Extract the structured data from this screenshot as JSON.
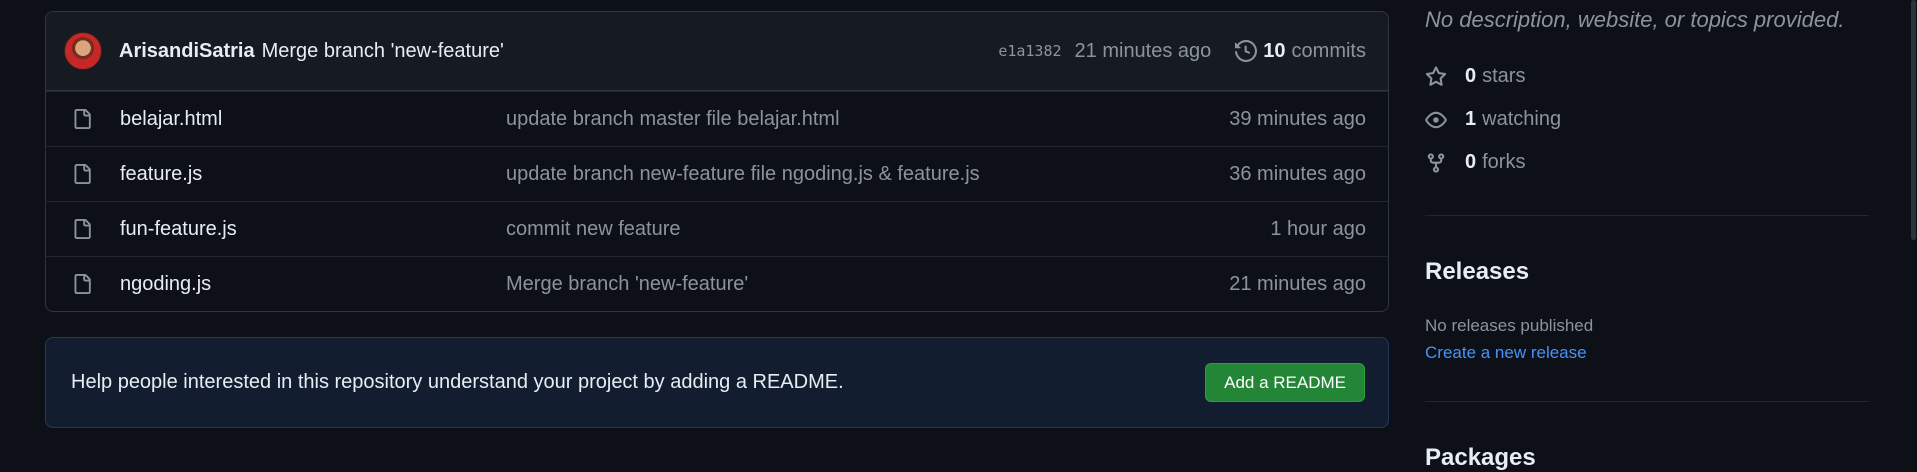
{
  "commit": {
    "author": "ArisandiSatria",
    "message": "Merge branch 'new-feature'",
    "sha": "e1a1382",
    "time": "21 minutes ago",
    "commit_count": "10",
    "commits_label": "commits"
  },
  "files": [
    {
      "name": "belajar.html",
      "message": "update branch master file belajar.html",
      "age": "39 minutes ago"
    },
    {
      "name": "feature.js",
      "message": "update branch new-feature file ngoding.js & feature.js",
      "age": "36 minutes ago"
    },
    {
      "name": "fun-feature.js",
      "message": "commit new feature",
      "age": "1 hour ago"
    },
    {
      "name": "ngoding.js",
      "message": "Merge branch 'new-feature'",
      "age": "21 minutes ago"
    }
  ],
  "readme": {
    "text": "Help people interested in this repository understand your project by adding a README.",
    "button": "Add a README"
  },
  "about": {
    "description": "No description, website, or topics provided.",
    "stars_count": "0",
    "stars_label": "stars",
    "watching_count": "1",
    "watching_label": "watching",
    "forks_count": "0",
    "forks_label": "forks"
  },
  "releases": {
    "title": "Releases",
    "none": "No releases published",
    "create_link": "Create a new release"
  },
  "packages": {
    "title": "Packages"
  },
  "colors": {
    "accent_link": "#4493f8",
    "button_green": "#238636",
    "bg": "#0d1117"
  }
}
